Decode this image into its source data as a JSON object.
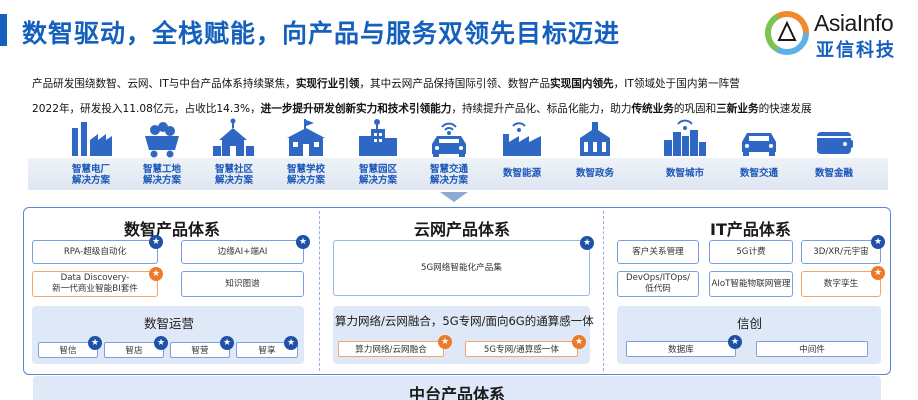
{
  "header": {
    "title": "数智驱动，全栈赋能，向产品与服务双领先目标迈进",
    "logo_en": "AsiaInfo",
    "logo_cn": "亚信科技",
    "accent_color": "#1560bd"
  },
  "description": {
    "line1_segments": [
      {
        "text": "产品研发围绕数智、云网、IT与中台产品体系持续聚焦，",
        "bold": false
      },
      {
        "text": "实现行业引领",
        "bold": true
      },
      {
        "text": "，其中云网产品保持国际引领、数智产品",
        "bold": false
      },
      {
        "text": "实现国内领先",
        "bold": true
      },
      {
        "text": "，IT领域处于国内第一阵营",
        "bold": false
      }
    ],
    "line2_segments": [
      {
        "text": "2022年，研发投入11.08亿元，占收比14.3%，",
        "bold": false
      },
      {
        "text": "进一步提升研发创新实力和技术引领能力",
        "bold": true
      },
      {
        "text": "，持续提升产品化、标品化能力，助力",
        "bold": false
      },
      {
        "text": "传统业务",
        "bold": true
      },
      {
        "text": "的巩固和",
        "bold": false
      },
      {
        "text": "三新业务",
        "bold": true
      },
      {
        "text": "的快速发展",
        "bold": false
      }
    ]
  },
  "industries": [
    {
      "icon": "power-plant-icon",
      "label": "智慧电厂\n解决方案"
    },
    {
      "icon": "mining-cart-icon",
      "label": "智慧工地\n解决方案"
    },
    {
      "icon": "community-icon",
      "label": "智慧社区\n解决方案"
    },
    {
      "icon": "school-icon",
      "label": "智慧学校\n解决方案"
    },
    {
      "icon": "park-icon",
      "label": "智慧园区\n解决方案"
    },
    {
      "icon": "traffic-car-icon",
      "label": "智慧交通\n解决方案"
    },
    {
      "icon": "factory-energy-icon",
      "label": "数智能源"
    },
    {
      "icon": "government-icon",
      "label": "数智政务"
    },
    {
      "icon": "city-icon",
      "label": "数智城市"
    },
    {
      "icon": "car-icon",
      "label": "数智交通"
    },
    {
      "icon": "finance-icon",
      "label": "数智金融"
    }
  ],
  "sections": {
    "data_intel": {
      "title": "数智产品体系",
      "boxes": [
        "RPA-超级自动化",
        "边缘AI+端AI",
        "Data Discovery-\n新一代商业智能BI套件",
        "知识图谱"
      ],
      "ops_title": "数智运营",
      "ops_items": [
        "智信",
        "智店",
        "智营",
        "智享"
      ]
    },
    "cloud_net": {
      "title": "云网产品体系",
      "main_box": "5G网络智能化产品集",
      "integration_title": "算力网络/云网融合，5G专网/面向6G的通算感一体",
      "items": [
        "算力网络/云网融合",
        "5G专网/通算感一体"
      ]
    },
    "it": {
      "title": "IT产品体系",
      "boxes": [
        "客户关系管理",
        "5G计费",
        "3D/XR/元宇宙",
        "DevOps/ITOps/\n低代码",
        "AIoT智能物联网管理",
        "数字孪生"
      ],
      "xinchuang_title": "信创",
      "xinchuang_items": [
        "数据库",
        "中间件"
      ]
    },
    "middle": {
      "title": "中台产品体系"
    }
  },
  "colors": {
    "primary_blue": "#1560bd",
    "star_blue": "#1f52a6",
    "star_orange": "#ec7a2a",
    "panel_bg": "#dfe8f6"
  }
}
